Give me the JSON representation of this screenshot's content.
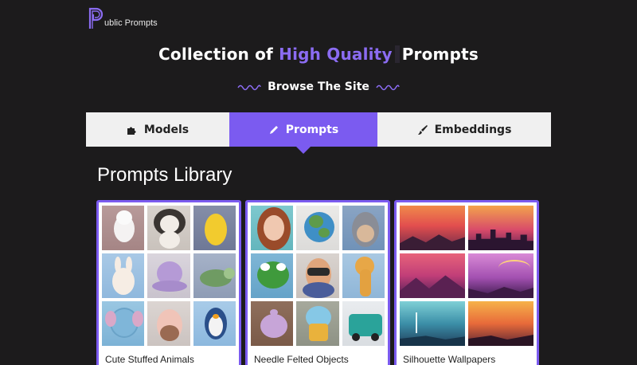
{
  "brand": {
    "logo_text": "ublic Prompts",
    "accent": "#7b5bf0"
  },
  "hero": {
    "title_part1": "Collection of",
    "title_highlight": "High Quality",
    "title_part2": "Prompts",
    "browse_label": "Browse The Site"
  },
  "tabs": [
    {
      "label": "Models",
      "icon": "puzzle-icon",
      "active": false
    },
    {
      "label": "Prompts",
      "icon": "pen-icon",
      "active": true
    },
    {
      "label": "Embeddings",
      "icon": "brush-icon",
      "active": false
    }
  ],
  "library": {
    "title": "Prompts Library",
    "cards": [
      {
        "label": "Cute Stuffed Animals",
        "thumbnail_count": 9
      },
      {
        "label": "Needle Felted Objects",
        "thumbnail_count": 9
      },
      {
        "label": "Silhouette Wallpapers",
        "thumbnail_count": 6
      }
    ]
  }
}
